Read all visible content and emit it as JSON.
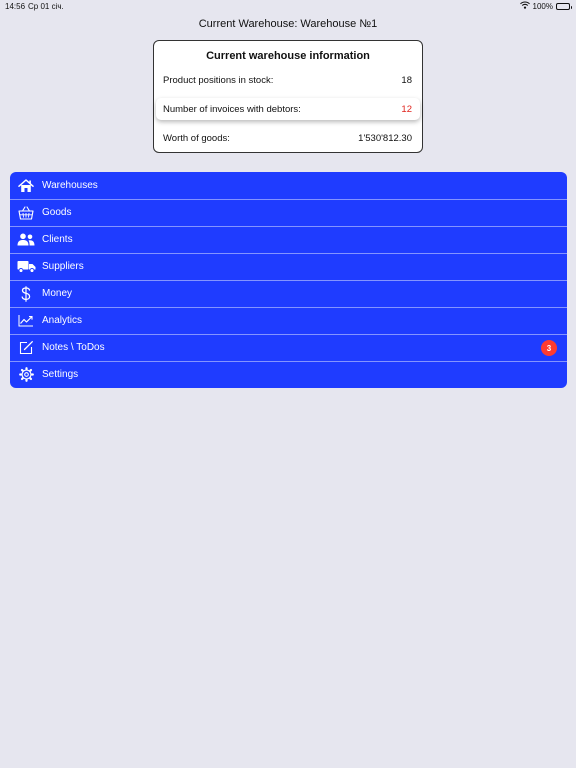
{
  "status_bar": {
    "time": "14:56",
    "date": "Ср 01 січ.",
    "battery": "100%"
  },
  "header": {
    "title": "Current Warehouse: Warehouse №1"
  },
  "info_card": {
    "title": "Current warehouse information",
    "rows": [
      {
        "label": "Product positions in stock:",
        "value": "18"
      },
      {
        "label": "Number of invoices with debtors:",
        "value": "12"
      },
      {
        "label": "Worth of goods:",
        "value": "1'530'812.30"
      }
    ],
    "debtor_color": "#e0231d"
  },
  "menu": {
    "accent": "#1f3cff",
    "items": [
      {
        "label": "Warehouses",
        "icon": "house-icon"
      },
      {
        "label": "Goods",
        "icon": "basket-icon"
      },
      {
        "label": "Clients",
        "icon": "people-icon"
      },
      {
        "label": "Suppliers",
        "icon": "truck-icon"
      },
      {
        "label": "Money",
        "icon": "dollar-icon"
      },
      {
        "label": "Analytics",
        "icon": "chart-line-icon"
      },
      {
        "label": "Notes \\ ToDos",
        "icon": "note-pencil-icon",
        "badge": "3"
      },
      {
        "label": "Settings",
        "icon": "gear-icon"
      }
    ]
  }
}
